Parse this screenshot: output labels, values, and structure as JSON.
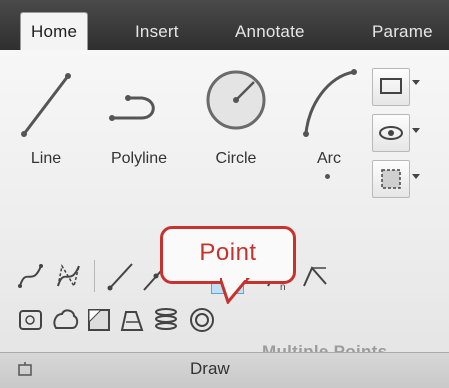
{
  "ribbon": {
    "tabs": [
      {
        "label": "Home",
        "active": true
      },
      {
        "label": "Insert"
      },
      {
        "label": "Annotate"
      },
      {
        "label": "Parame"
      }
    ]
  },
  "draw_panel": {
    "tools": [
      {
        "label": "Line",
        "icon": "line-icon"
      },
      {
        "label": "Polyline",
        "icon": "polyline-icon"
      },
      {
        "label": "Circle",
        "icon": "circle-icon"
      },
      {
        "label": "Arc",
        "icon": "arc-icon"
      }
    ],
    "title": "Draw"
  },
  "callout": {
    "text": "Point"
  },
  "tooltip": {
    "text": "Multiple Points"
  },
  "colors": {
    "accent_red": "#c7332c",
    "highlight_blue": "#bfe1f6"
  }
}
